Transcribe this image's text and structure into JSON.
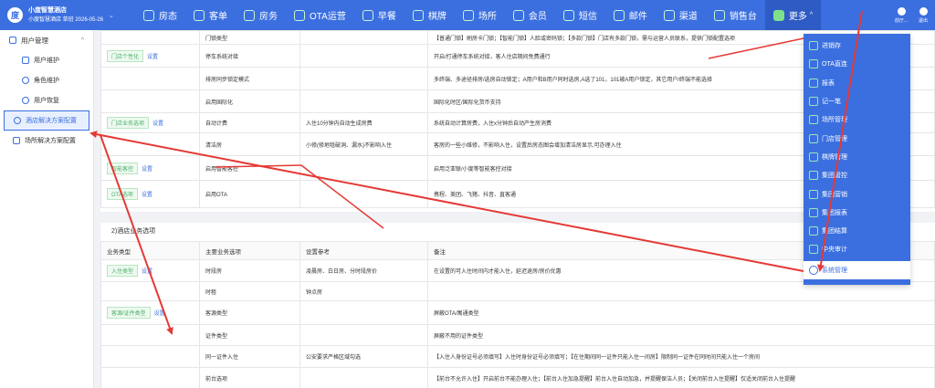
{
  "brand": {
    "name": "小度智慧酒店",
    "sub": "小度智慧酒店 草班 2026-05-26",
    "logo_char": "度"
  },
  "nav": [
    {
      "label": "房态",
      "icon": "grid-icon"
    },
    {
      "label": "客单",
      "icon": "receipt-icon"
    },
    {
      "label": "房务",
      "icon": "building-icon"
    },
    {
      "label": "OTA运营",
      "icon": "monitor-icon"
    },
    {
      "label": "早餐",
      "icon": "breakfast-icon"
    },
    {
      "label": "棋牌",
      "icon": "chess-icon"
    },
    {
      "label": "场所",
      "icon": "venue-icon"
    },
    {
      "label": "会员",
      "icon": "member-card-icon"
    },
    {
      "label": "短信",
      "icon": "sms-icon"
    },
    {
      "label": "邮件",
      "icon": "mail-icon"
    },
    {
      "label": "渠道",
      "icon": "channel-icon"
    },
    {
      "label": "销售台",
      "icon": "user-icon"
    }
  ],
  "nav_more": {
    "label": "更多",
    "chevron": "^"
  },
  "top_right": [
    {
      "label": "前厅..."
    },
    {
      "label": "退出"
    }
  ],
  "sidebar": {
    "group": "用户管理",
    "group_chevron": "^",
    "items": [
      "用户维护",
      "角色维护",
      "用户恢复"
    ],
    "top_items": [
      "酒店解决方案配置",
      "场所解决方案配置"
    ]
  },
  "section1": {
    "rows": [
      {
        "cat": "",
        "link": "",
        "name": "门锁类型",
        "ref": "",
        "note": "【普通门锁】刷房卡门锁；【智能门锁】人脸或密码锁；【多款门锁】门店有多款门锁，需与运营人员联系，提供门锁配置选项"
      },
      {
        "cat": "门店个性化",
        "link": "设置",
        "name": "停车系统对接",
        "ref": "",
        "note": "开启/打通停车系统对接，客人住店期间免费通行"
      },
      {
        "cat": "",
        "link": "",
        "name": "排房同步锁定模式",
        "ref": "",
        "note": "多终端、多途径排房/选房自动锁定；A用户和B用户同时选房,A选了101，101被A用户锁定，其它用户/终端不能选择"
      },
      {
        "cat": "",
        "link": "",
        "name": "启用国际化",
        "ref": "",
        "note": "国际化时区/国际化货币支持"
      },
      {
        "cat": "门店业务选项",
        "link": "设置",
        "name": "自动计费",
        "ref": "入住10分钟内自动生成房费",
        "note": "系统自动计算房费，入住x分钟后自动产生房消费"
      },
      {
        "cat": "",
        "link": "",
        "name": "清洁房",
        "ref": "小修(修地毯破洞、漏水)不影响入住",
        "note": "客房的一些小维修，不影响入住，设置后房态图会增加清洁房显示,可办理入住"
      },
      {
        "cat": "智能客控",
        "link": "设置",
        "name": "启用智能客控",
        "ref": "",
        "note": "启用泛亚联/小度等智能客控对接"
      },
      {
        "cat": "OTA选项",
        "link": "设置",
        "name": "启用OTA",
        "ref": "",
        "note": "携程、美团、飞猪、抖音、直客通"
      }
    ]
  },
  "section2": {
    "title": "2)酒店业务选项",
    "headers": [
      "业务类型",
      "主要业务选项",
      "设置参考",
      "备注"
    ],
    "rows": [
      {
        "cat": "入住类型",
        "link": "设置",
        "name": "时段房",
        "ref": "凌晨房、白日房、分时段房价",
        "note": "在设置的可入住时间内才能入住，延迟退房/房价优惠"
      },
      {
        "cat": "",
        "link": "",
        "name": "时租",
        "ref": "钟点房",
        "note": ""
      },
      {
        "cat": "客源/证件类型",
        "link": "设置",
        "name": "客源类型",
        "ref": "",
        "note": "屏蔽OTA/寓通类型"
      },
      {
        "cat": "",
        "link": "",
        "name": "证件类型",
        "ref": "",
        "note": "屏蔽不用的证件类型"
      },
      {
        "cat": "",
        "link": "",
        "name": "同一证件入住",
        "ref": "公安要求严格区域勾选",
        "note": "【入住人身份证号必须填写】入住时身份证号必须填写；【在住期间同一证件只能入住一间房】限制同一证件在同时间只能入住一个房间"
      },
      {
        "cat": "",
        "link": "",
        "name": "前台选项",
        "ref": "",
        "note": "【前台不允许入住】开启前台不能办理入住；【前台入住加急提醒】前台入住自动加急，并提醒保洁人员；【关闭前台入住提醒】仅适关闭前台入住提醒"
      }
    ]
  },
  "more_menu": {
    "items": [
      {
        "label": "进销存",
        "icon": "inventory-icon"
      },
      {
        "label": "OTA直连",
        "icon": "ota-icon"
      },
      {
        "label": "报表",
        "icon": "report-icon"
      },
      {
        "label": "记一笔",
        "icon": "note-icon"
      },
      {
        "label": "场所管理",
        "icon": "venue-icon"
      },
      {
        "label": "门店管理",
        "icon": "store-icon"
      },
      {
        "label": "棋牌管理",
        "icon": "chess-icon"
      },
      {
        "label": "集团管控",
        "icon": "group-icon"
      },
      {
        "label": "集团营销",
        "icon": "marketing-icon"
      },
      {
        "label": "集团报表",
        "icon": "group-report-icon"
      },
      {
        "label": "集团结算",
        "icon": "settlement-icon"
      },
      {
        "label": "中央审计",
        "icon": "audit-icon"
      },
      {
        "label": "系统管理",
        "icon": "gear-icon"
      }
    ]
  },
  "colors": {
    "primary": "#3b6fe0",
    "annotation": "#e53935",
    "tag_green": "#4caf6b"
  }
}
